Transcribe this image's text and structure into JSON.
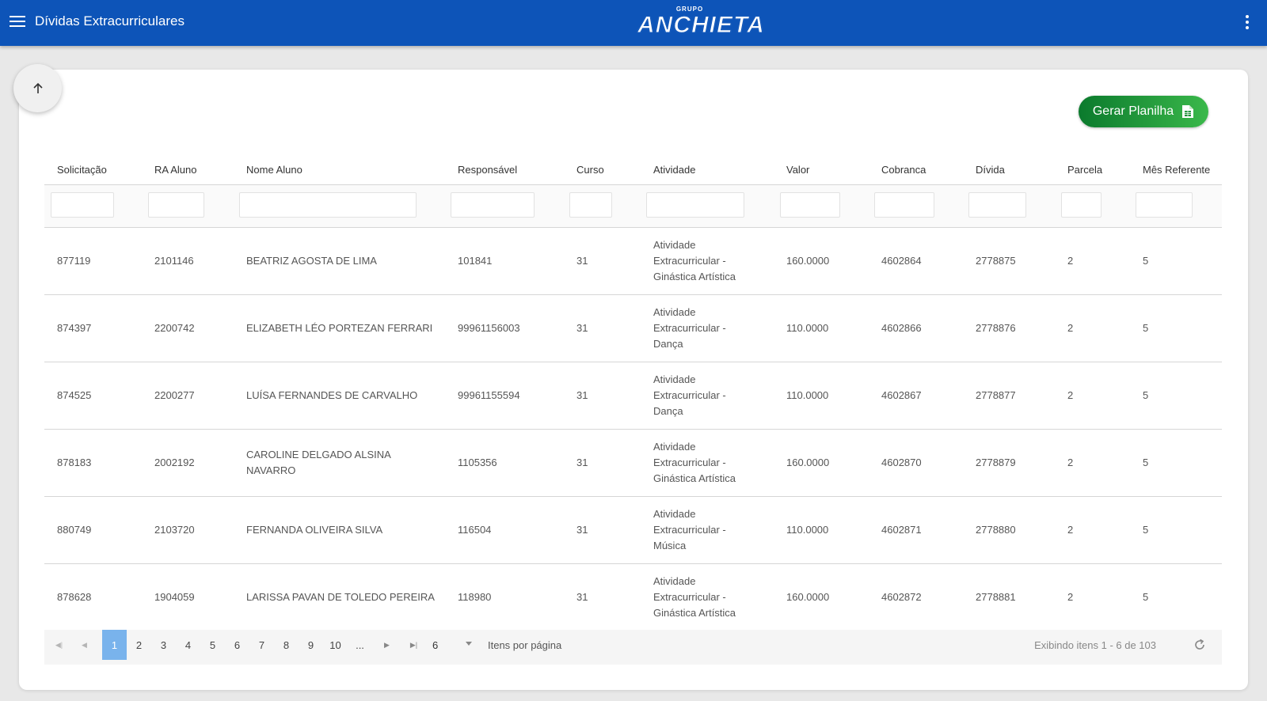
{
  "app": {
    "title": "Dívidas Extracurriculares",
    "menu_icon": "menu-icon",
    "more_icon": "more-vert-icon",
    "logo_small": "GRUPO",
    "logo_main": "ANCHIETA",
    "brand_color": "#0d54b8"
  },
  "actions": {
    "scroll_top_icon": "arrow-up-icon",
    "generate_label": "Gerar Planilha",
    "generate_icon": "spreadsheet-file-icon",
    "generate_color": "#1a8f35"
  },
  "table": {
    "columns": [
      "Solicitação",
      "RA Aluno",
      "Nome Aluno",
      "Responsável",
      "Curso",
      "Atividade",
      "Valor",
      "Cobranca",
      "Dívida",
      "Parcela",
      "Mês Referente"
    ],
    "rows": [
      {
        "solicitacao": "877119",
        "ra": "2101146",
        "nome": "BEATRIZ AGOSTA DE LIMA",
        "responsavel": "101841",
        "curso": "31",
        "atividade": "Atividade Extracurricular - Ginástica Artística",
        "valor": "160.0000",
        "cobranca": "4602864",
        "divida": "2778875",
        "parcela": "2",
        "mes": "5"
      },
      {
        "solicitacao": "874397",
        "ra": "2200742",
        "nome": "ELIZABETH LÉO PORTEZAN FERRARI",
        "responsavel": "99961156003",
        "curso": "31",
        "atividade": "Atividade Extracurricular - Dança",
        "valor": "110.0000",
        "cobranca": "4602866",
        "divida": "2778876",
        "parcela": "2",
        "mes": "5"
      },
      {
        "solicitacao": "874525",
        "ra": "2200277",
        "nome": "LUÍSA FERNANDES DE CARVALHO",
        "responsavel": "99961155594",
        "curso": "31",
        "atividade": "Atividade Extracurricular - Dança",
        "valor": "110.0000",
        "cobranca": "4602867",
        "divida": "2778877",
        "parcela": "2",
        "mes": "5"
      },
      {
        "solicitacao": "878183",
        "ra": "2002192",
        "nome": "CAROLINE DELGADO ALSINA NAVARRO",
        "responsavel": "1105356",
        "curso": "31",
        "atividade": "Atividade Extracurricular - Ginástica Artística",
        "valor": "160.0000",
        "cobranca": "4602870",
        "divida": "2778879",
        "parcela": "2",
        "mes": "5"
      },
      {
        "solicitacao": "880749",
        "ra": "2103720",
        "nome": "FERNANDA OLIVEIRA SILVA",
        "responsavel": "116504",
        "curso": "31",
        "atividade": "Atividade Extracurricular - Música",
        "valor": "110.0000",
        "cobranca": "4602871",
        "divida": "2778880",
        "parcela": "2",
        "mes": "5"
      },
      {
        "solicitacao": "878628",
        "ra": "1904059",
        "nome": "LARISSA PAVAN DE TOLEDO PEREIRA",
        "responsavel": "118980",
        "curso": "31",
        "atividade": "Atividade Extracurricular - Ginástica Artística",
        "valor": "160.0000",
        "cobranca": "4602872",
        "divida": "2778881",
        "parcela": "2",
        "mes": "5"
      }
    ]
  },
  "pager": {
    "pages": [
      "1",
      "2",
      "3",
      "4",
      "5",
      "6",
      "7",
      "8",
      "9",
      "10",
      "..."
    ],
    "current_page": "1",
    "items_per_page": "6",
    "items_per_page_label": "Itens por página",
    "info": "Exibindo itens 1 - 6 de 103",
    "first_icon": "first-page-icon",
    "prev_icon": "prev-page-icon",
    "next_icon": "next-page-icon",
    "last_icon": "last-page-icon",
    "refresh_icon": "refresh-icon"
  }
}
